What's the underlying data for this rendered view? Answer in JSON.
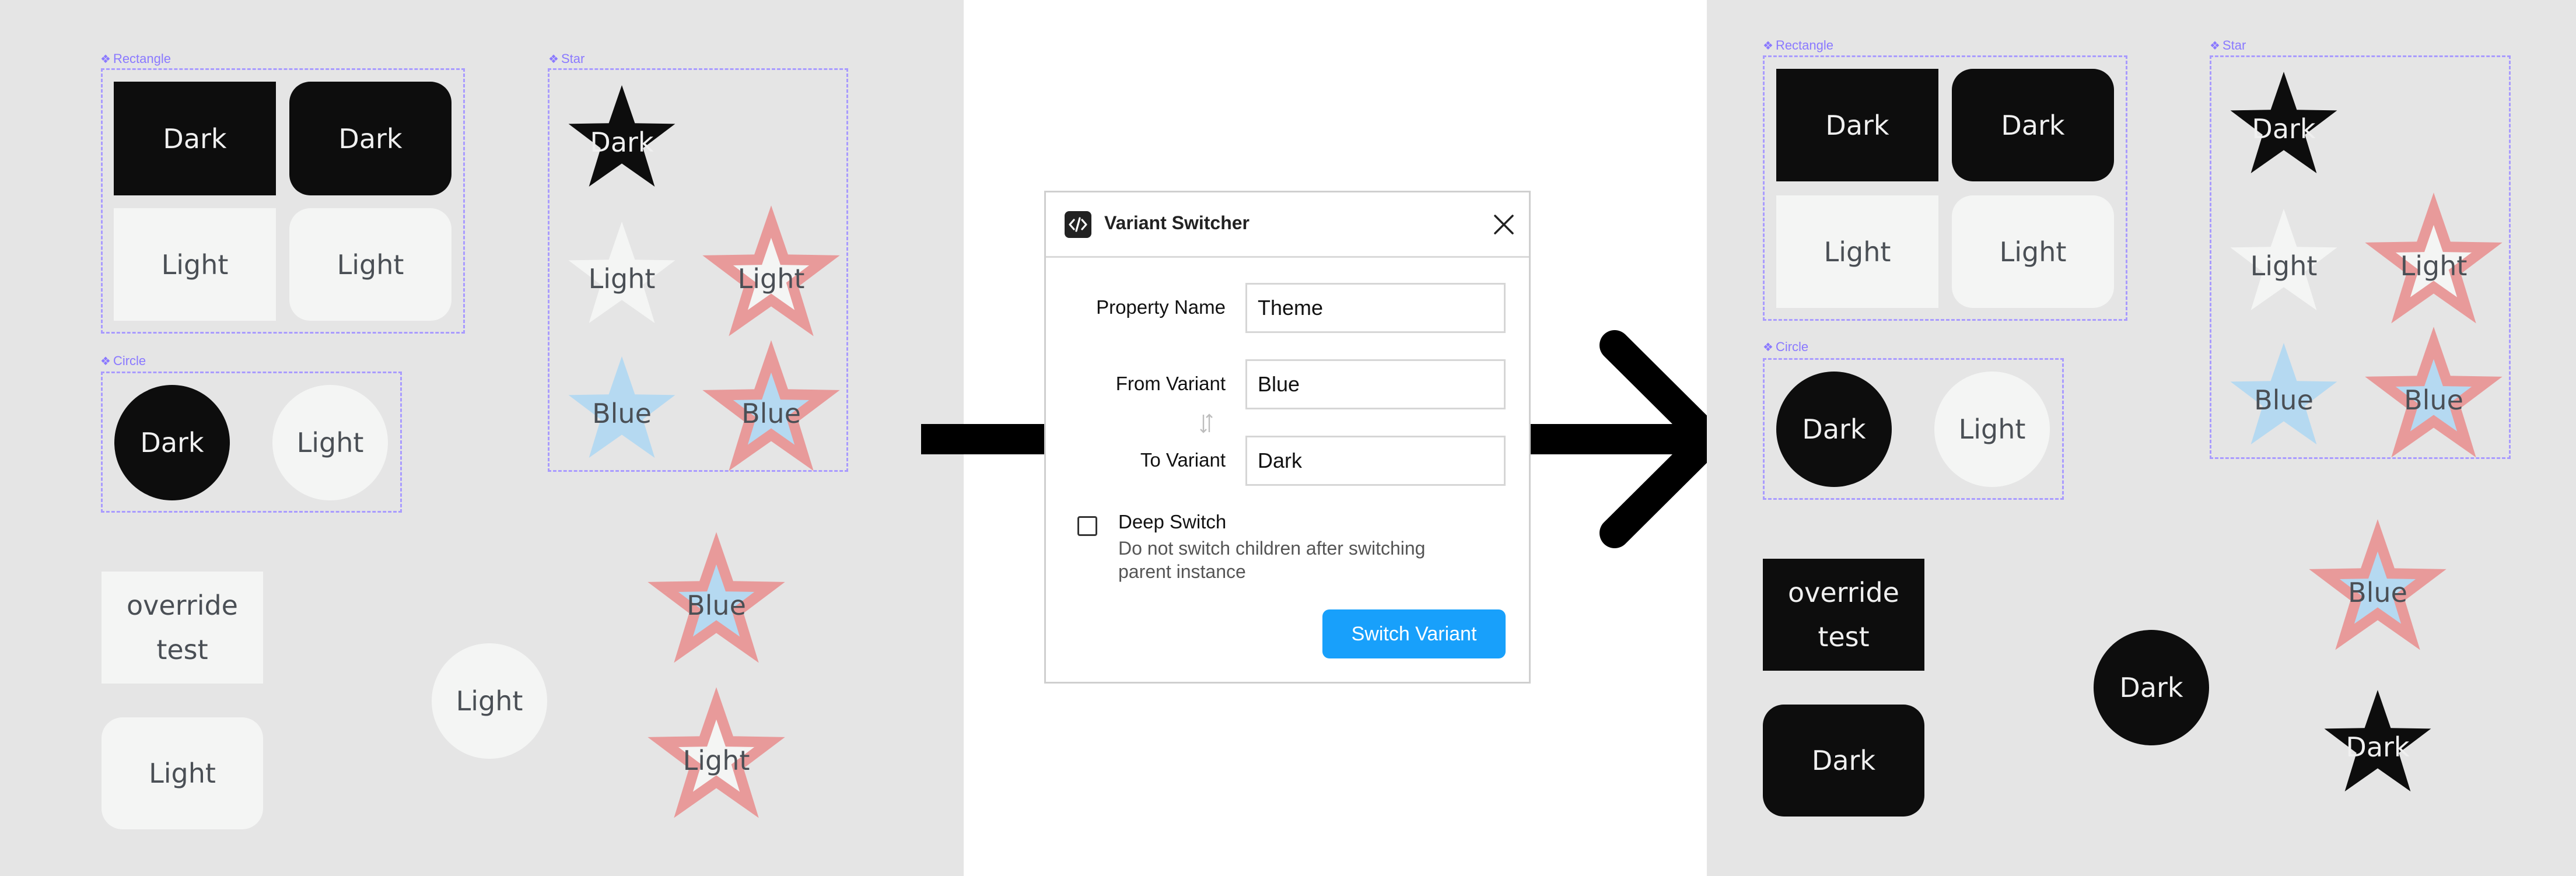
{
  "colors": {
    "canvas": "#e5e5e5",
    "group_outline": "#a99bff",
    "dark_fill": "#0d0d0d",
    "light_fill": "#f4f5f4",
    "blue_fill": "#b5d9f1",
    "star_stroke_red": "#e89a9a",
    "primary": "#18a0fb"
  },
  "left_panel": {
    "rectangle_group": {
      "title": "Rectangle",
      "cells": [
        "Dark",
        "Dark",
        "Light",
        "Light"
      ]
    },
    "circle_group": {
      "title": "Circle",
      "cells": [
        "Dark",
        "Light"
      ]
    },
    "star_group": {
      "title": "Star",
      "cells": [
        "Dark",
        "Light",
        "Light",
        "Blue",
        "Blue"
      ]
    },
    "loose": {
      "override_line1": "override",
      "override_line2": "test",
      "rounded_light": "Light",
      "circle_light": "Light",
      "star_blue": "Blue",
      "star_light": "Light"
    }
  },
  "dialog": {
    "icon": "code-icon",
    "title": "Variant Switcher",
    "close_icon": "close-icon",
    "property_name_label": "Property Name",
    "property_name_value": "Theme",
    "from_label": "From Variant",
    "from_value": "Blue",
    "swap_icon": "swap-vertical-icon",
    "to_label": "To Variant",
    "to_value": "Dark",
    "deep_switch_label": "Deep Switch",
    "deep_switch_checked": false,
    "deep_switch_desc": "Do not switch children after switching parent instance",
    "submit_label": "Switch Variant"
  },
  "right_panel": {
    "rectangle_group": {
      "title": "Rectangle",
      "cells": [
        "Dark",
        "Dark",
        "Light",
        "Light"
      ]
    },
    "circle_group": {
      "title": "Circle",
      "cells": [
        "Dark",
        "Light"
      ]
    },
    "star_group": {
      "title": "Star",
      "cells": [
        "Dark",
        "Light",
        "Light",
        "Blue",
        "Blue"
      ]
    },
    "loose": {
      "override_line1": "override",
      "override_line2": "test",
      "rounded_dark": "Dark",
      "circle_dark": "Dark",
      "star_blue": "Blue",
      "star_dark": "Dark"
    }
  }
}
